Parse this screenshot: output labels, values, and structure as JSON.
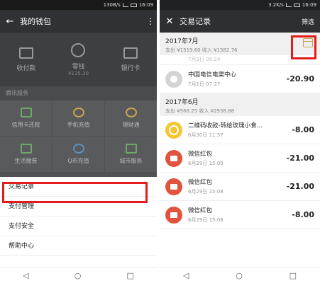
{
  "left": {
    "status": "130B/s",
    "time": "16:09",
    "title": "我的钱包",
    "wallet": [
      {
        "label": "收付款",
        "sub": ""
      },
      {
        "label": "零钱",
        "sub": "¥135.30"
      },
      {
        "label": "银行卡",
        "sub": ""
      }
    ],
    "section": "腾讯服务",
    "grid": [
      "信用卡还款",
      "手机充值",
      "理财通",
      "生活缴费",
      "Q币充值",
      "城市服务"
    ],
    "menu": [
      "交易记录",
      "支付管理",
      "支付安全",
      "帮助中心"
    ]
  },
  "right": {
    "status": "3.2K/s",
    "time": "16:09",
    "title": "交易记录",
    "filter": "筛选",
    "months": [
      {
        "month": "2017年7月",
        "summary": "支出 ¥1519.60 收入 ¥1582.76",
        "partial_date": "7月3日 09:24",
        "items": [
          {
            "name": "中国电信电渠中心",
            "date": "7月1日 07:27",
            "amount": "-20.90",
            "avatar": "grey"
          }
        ]
      },
      {
        "month": "2017年6月",
        "summary": "支出 ¥568.25 收入 ¥2938.88",
        "items": [
          {
            "name": "二维码收款-转给玫瑰小食...",
            "date": "6月30日 11:57",
            "amount": "-8.00",
            "avatar": "yellow"
          },
          {
            "name": "微信红包",
            "date": "6月29日 15:09",
            "amount": "-21.00",
            "avatar": "red"
          },
          {
            "name": "微信红包",
            "date": "6月29日 15:08",
            "amount": "-21.00",
            "avatar": "red"
          },
          {
            "name": "微信红包",
            "date": "6月29日 15:08",
            "amount": "-8.00",
            "avatar": "red"
          }
        ]
      }
    ]
  },
  "colors": {
    "highlight": "#e21b1b",
    "topbar": "#2f3134"
  }
}
